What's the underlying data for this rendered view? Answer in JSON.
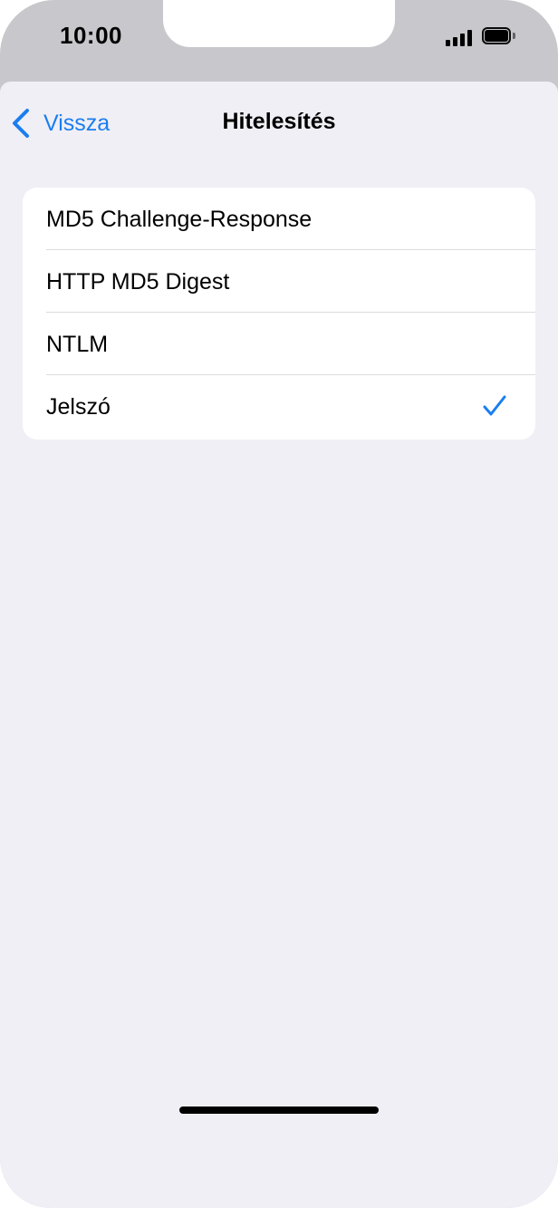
{
  "status_bar": {
    "time": "10:00",
    "signal_icon": "cellular-signal-icon",
    "battery_icon": "battery-full-icon"
  },
  "nav": {
    "back_label": "Vissza",
    "back_icon": "chevron-left-icon",
    "title": "Hitelesítés"
  },
  "auth_options": [
    {
      "label": "MD5 Challenge-Response",
      "selected": false
    },
    {
      "label": "HTTP MD5 Digest",
      "selected": false
    },
    {
      "label": "NTLM",
      "selected": false
    },
    {
      "label": "Jelszó",
      "selected": true
    }
  ],
  "colors": {
    "accent": "#1a7ef0",
    "background": "#f0eff5",
    "card": "#ffffff",
    "frame": "#c7c7cc"
  }
}
